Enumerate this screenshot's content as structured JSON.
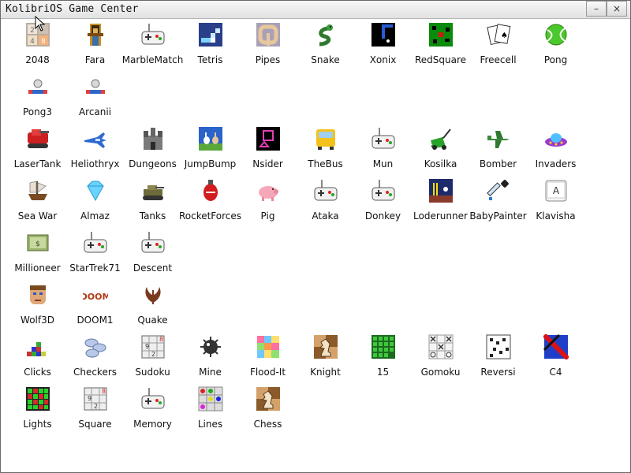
{
  "window": {
    "title": "KolibriOS Game Center",
    "minimize_glyph": "–",
    "close_glyph": "×"
  },
  "apps": [
    {
      "label": "2048",
      "icon": "2048-tiles-icon",
      "row": 0,
      "col": 0
    },
    {
      "label": "Fara",
      "icon": "pharaoh-icon",
      "row": 0,
      "col": 1
    },
    {
      "label": "MarbleMatch",
      "icon": "gamepad-icon",
      "row": 0,
      "col": 2
    },
    {
      "label": "Tetris",
      "icon": "tetris-icon",
      "row": 0,
      "col": 3
    },
    {
      "label": "Pipes",
      "icon": "pipes-icon",
      "row": 0,
      "col": 4
    },
    {
      "label": "Snake",
      "icon": "snake-icon",
      "row": 0,
      "col": 5
    },
    {
      "label": "Xonix",
      "icon": "xonix-icon",
      "row": 0,
      "col": 6
    },
    {
      "label": "RedSquare",
      "icon": "redsquare-icon",
      "row": 0,
      "col": 7
    },
    {
      "label": "Freecell",
      "icon": "cards-icon",
      "row": 0,
      "col": 8
    },
    {
      "label": "Pong",
      "icon": "tennis-ball-icon",
      "row": 0,
      "col": 9
    },
    {
      "label": "Pong3",
      "icon": "paddle-ball-icon",
      "row": 1,
      "col": 0
    },
    {
      "label": "Arcanii",
      "icon": "paddle-ball-icon",
      "row": 1,
      "col": 1
    },
    {
      "label": "LaserTank",
      "icon": "tank-icon",
      "row": 2,
      "col": 0
    },
    {
      "label": "Heliothryx",
      "icon": "jet-icon",
      "row": 2,
      "col": 1
    },
    {
      "label": "Dungeons",
      "icon": "castle-icon",
      "row": 2,
      "col": 2
    },
    {
      "label": "JumpBump",
      "icon": "bunnies-icon",
      "row": 2,
      "col": 3
    },
    {
      "label": "Nsider",
      "icon": "nsider-icon",
      "row": 2,
      "col": 4
    },
    {
      "label": "TheBus",
      "icon": "bus-icon",
      "row": 2,
      "col": 5
    },
    {
      "label": "Mun",
      "icon": "gamepad-icon",
      "row": 2,
      "col": 6
    },
    {
      "label": "Kosilka",
      "icon": "lawnmower-icon",
      "row": 2,
      "col": 7
    },
    {
      "label": "Bomber",
      "icon": "plane-icon",
      "row": 2,
      "col": 8
    },
    {
      "label": "Invaders",
      "icon": "ufo-icon",
      "row": 2,
      "col": 9
    },
    {
      "label": "Sea War",
      "icon": "ship-icon",
      "row": 3,
      "col": 0,
      "clip": true
    },
    {
      "label": "Almaz",
      "icon": "diamond-icon",
      "row": 3,
      "col": 1
    },
    {
      "label": "Tanks",
      "icon": "army-tank-icon",
      "row": 3,
      "col": 2
    },
    {
      "label": "RocketForces",
      "icon": "bomb-icon",
      "row": 3,
      "col": 3
    },
    {
      "label": "Pig",
      "icon": "pig-icon",
      "row": 3,
      "col": 4
    },
    {
      "label": "Ataka",
      "icon": "gamepad-icon",
      "row": 3,
      "col": 5
    },
    {
      "label": "Donkey",
      "icon": "gamepad-icon",
      "row": 3,
      "col": 6
    },
    {
      "label": "Loderunner",
      "icon": "loderunner-icon",
      "row": 3,
      "col": 7
    },
    {
      "label": "BabyPainter",
      "icon": "pipette-icon",
      "row": 3,
      "col": 8
    },
    {
      "label": "Klavisha",
      "icon": "key-a-icon",
      "row": 3,
      "col": 9
    },
    {
      "label": "Millioneer",
      "icon": "money-icon",
      "row": 4,
      "col": 0
    },
    {
      "label": "StarTrek71",
      "icon": "gamepad-icon",
      "row": 4,
      "col": 1
    },
    {
      "label": "Descent",
      "icon": "gamepad-icon",
      "row": 4,
      "col": 2
    },
    {
      "label": "Wolf3D",
      "icon": "face-icon",
      "row": 5,
      "col": 0
    },
    {
      "label": "DOOM1",
      "icon": "doom-logo-icon",
      "row": 5,
      "col": 1
    },
    {
      "label": "Quake",
      "icon": "quake-logo-icon",
      "row": 5,
      "col": 2
    },
    {
      "label": "Clicks",
      "icon": "blocks-icon",
      "row": 6,
      "col": 0
    },
    {
      "label": "Checkers",
      "icon": "checkers-icon",
      "row": 6,
      "col": 1
    },
    {
      "label": "Sudoku",
      "icon": "sudoku-icon",
      "row": 6,
      "col": 2
    },
    {
      "label": "Mine",
      "icon": "mine-icon",
      "row": 6,
      "col": 3
    },
    {
      "label": "Flood-It",
      "icon": "floodit-icon",
      "row": 6,
      "col": 4
    },
    {
      "label": "Knight",
      "icon": "chess-knight-icon",
      "row": 6,
      "col": 5
    },
    {
      "label": "15",
      "icon": "green-grid-icon",
      "row": 6,
      "col": 6
    },
    {
      "label": "Gomoku",
      "icon": "gomoku-icon",
      "row": 6,
      "col": 7
    },
    {
      "label": "Reversi",
      "icon": "crossword-icon",
      "row": 6,
      "col": 8
    },
    {
      "label": "C4",
      "icon": "c4-icon",
      "row": 6,
      "col": 9
    },
    {
      "label": "Lights",
      "icon": "lights-icon",
      "row": 7,
      "col": 0
    },
    {
      "label": "Square",
      "icon": "sudoku-icon",
      "row": 7,
      "col": 1
    },
    {
      "label": "Memory",
      "icon": "gamepad-icon",
      "row": 7,
      "col": 2
    },
    {
      "label": "Lines",
      "icon": "lines-icon",
      "row": 7,
      "col": 3
    },
    {
      "label": "Chess",
      "icon": "chess-knight-icon",
      "row": 7,
      "col": 4
    }
  ]
}
